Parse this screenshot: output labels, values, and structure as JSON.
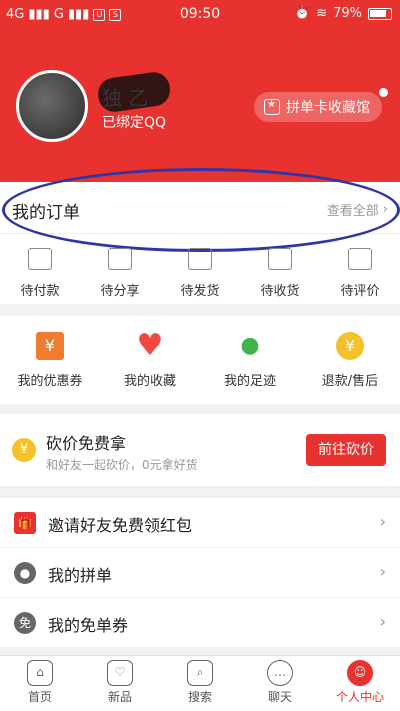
{
  "status_bar": {
    "network1": "4G",
    "network2": "G",
    "time": "09:50",
    "battery": "79%"
  },
  "profile": {
    "username": "独 乙",
    "bound_text": "已绑定QQ",
    "collect_button": "拼单卡收藏馆"
  },
  "orders": {
    "title": "我的订单",
    "view_all": "查看全部",
    "items": [
      {
        "label": "待付款",
        "icon": "wallet-icon"
      },
      {
        "label": "待分享",
        "icon": "share-people-icon"
      },
      {
        "label": "待发货",
        "icon": "box-icon"
      },
      {
        "label": "待收货",
        "icon": "truck-icon"
      },
      {
        "label": "待评价",
        "icon": "edit-icon"
      }
    ]
  },
  "services": [
    {
      "label": "我的优惠券",
      "icon": "coupon-icon"
    },
    {
      "label": "我的收藏",
      "icon": "heart-icon"
    },
    {
      "label": "我的足迹",
      "icon": "footprint-icon"
    },
    {
      "label": "退款/售后",
      "icon": "refund-icon"
    }
  ],
  "bargain": {
    "title": "砍价免费拿",
    "subtitle": "和好友一起砍价，0元拿好货",
    "button": "前往砍价"
  },
  "list": [
    {
      "label": "邀请好友免费领红包",
      "icon": "gift-icon"
    },
    {
      "label": "我的拼单",
      "icon": "group-icon"
    },
    {
      "label": "我的免单券",
      "icon": "free-coupon-icon"
    }
  ],
  "tabs": [
    {
      "label": "首页",
      "icon": "home-icon"
    },
    {
      "label": "新品",
      "icon": "bag-icon"
    },
    {
      "label": "搜索",
      "icon": "search-icon"
    },
    {
      "label": "聊天",
      "icon": "chat-icon"
    },
    {
      "label": "个人中心",
      "icon": "user-center-icon",
      "active": true
    }
  ],
  "colors": {
    "brand_red": "#e8322f",
    "annotation_blue": "#2f34a7"
  }
}
